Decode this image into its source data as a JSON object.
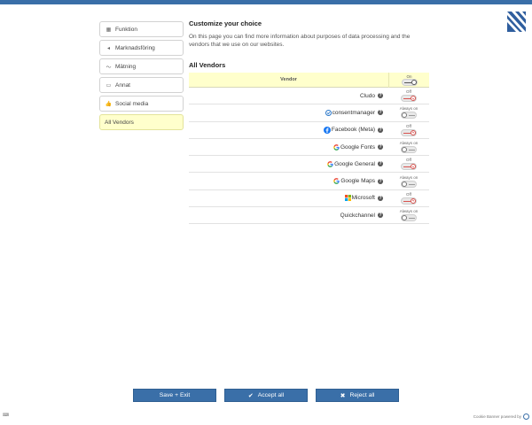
{
  "sidebar": {
    "items": [
      {
        "label": "Funktion",
        "icon": "grid-icon",
        "active": false
      },
      {
        "label": "Marknadsföring",
        "icon": "megaphone-icon",
        "active": false
      },
      {
        "label": "Mätning",
        "icon": "chart-line-icon",
        "active": false
      },
      {
        "label": "Annat",
        "icon": "chat-icon",
        "active": false
      },
      {
        "label": "Social media",
        "icon": "thumbs-up-icon",
        "active": false
      },
      {
        "label": "All Vendors",
        "icon": "",
        "active": true
      }
    ]
  },
  "main": {
    "title": "Customize your choice",
    "description": "On this page you can find more information about purposes of data processing and the vendors that we use on our websites.",
    "section_title": "All Vendors"
  },
  "vendor_table": {
    "header_vendor": "Vendor",
    "header_on": "On",
    "rows": [
      {
        "name": "Cludo",
        "logo": "",
        "state": "Off",
        "toggle": "off"
      },
      {
        "name": "consentmanager",
        "logo": "consentmanager-icon",
        "state": "Always on",
        "toggle": "always"
      },
      {
        "name": "Facebook (Meta)",
        "logo": "facebook-icon",
        "state": "Off",
        "toggle": "off"
      },
      {
        "name": "Google Fonts",
        "logo": "google-icon",
        "state": "Always on",
        "toggle": "always"
      },
      {
        "name": "Google General",
        "logo": "google-icon",
        "state": "Off",
        "toggle": "off"
      },
      {
        "name": "Google Maps",
        "logo": "google-icon",
        "state": "Always on",
        "toggle": "always"
      },
      {
        "name": "Microsoft",
        "logo": "microsoft-icon",
        "state": "Off",
        "toggle": "off"
      },
      {
        "name": "Quickchannel",
        "logo": "",
        "state": "Always on",
        "toggle": "always"
      }
    ]
  },
  "buttons": {
    "save": "Save + Exit",
    "accept": "Accept all",
    "reject": "Reject all"
  },
  "footer": {
    "powered": "Cookie Banner powered by"
  },
  "colors": {
    "accent": "#3a6fa8",
    "highlight": "#ffffcc",
    "off": "#d9534f"
  }
}
